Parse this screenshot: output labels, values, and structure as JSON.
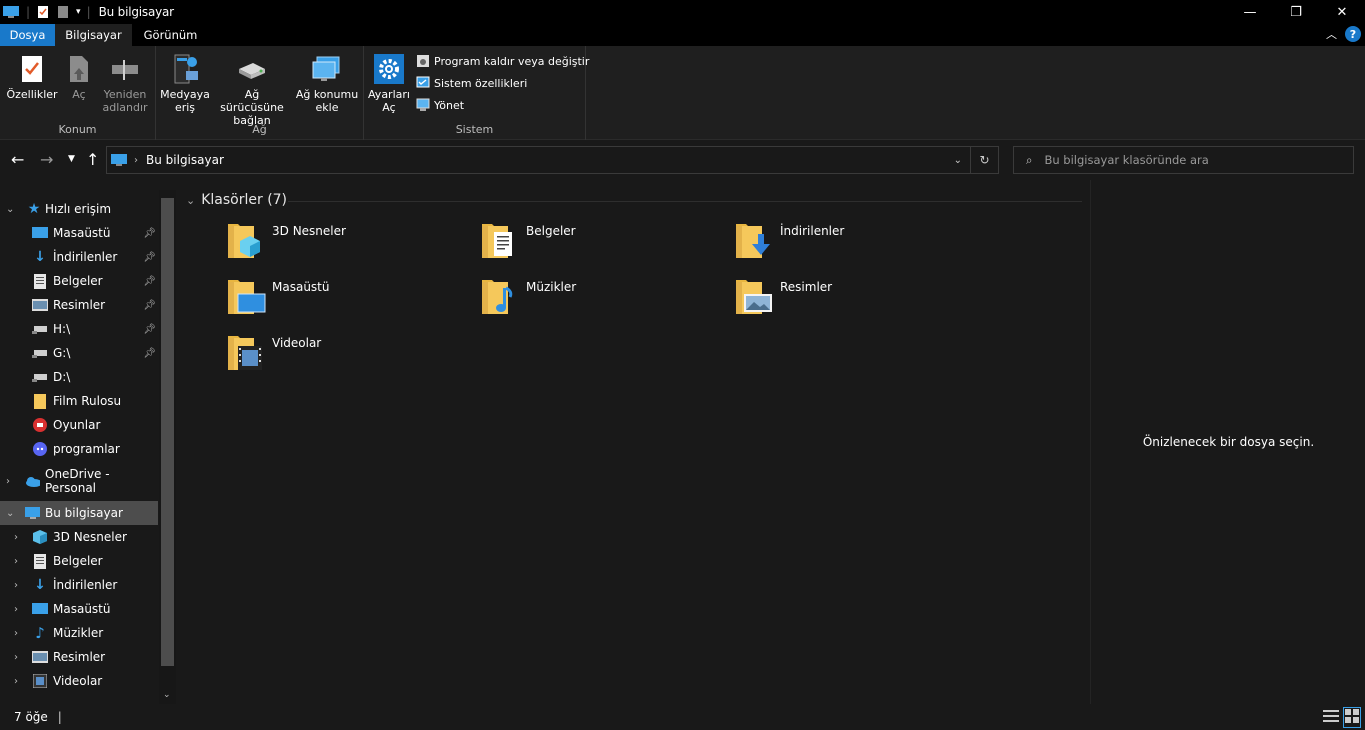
{
  "window": {
    "title": "Bu bilgisayar",
    "minimize": "—",
    "maximize": "❐",
    "close": "✕"
  },
  "ribbon_tabs": [
    "Dosya",
    "Bilgisayar",
    "Görünüm"
  ],
  "ribbon": {
    "konum": {
      "label": "Konum",
      "properties": "Özellikler",
      "open": "Aç",
      "rename_1": "Yeniden",
      "rename_2": "adlandır"
    },
    "ag": {
      "label": "Ağ",
      "media_1": "Medyaya",
      "media_2": "eriş",
      "map_drive_1": "Ağ sürücüsüne",
      "map_drive_2": "bağlan",
      "add_location_1": "Ağ konumu",
      "add_location_2": "ekle"
    },
    "sistem": {
      "label": "Sistem",
      "settings_1": "Ayarları",
      "settings_2": "Aç",
      "uninstall": "Program kaldır veya değiştir",
      "system_props": "Sistem özellikleri",
      "manage": "Yönet"
    }
  },
  "address": {
    "path": "Bu bilgisayar",
    "search_placeholder": "Bu bilgisayar klasöründe ara"
  },
  "nav": {
    "quick_access": "Hızlı erişim",
    "quick_items": [
      {
        "label": "Masaüstü",
        "pinned": true
      },
      {
        "label": "İndirilenler",
        "pinned": true
      },
      {
        "label": "Belgeler",
        "pinned": true
      },
      {
        "label": "Resimler",
        "pinned": true
      },
      {
        "label": "H:\\",
        "pinned": true
      },
      {
        "label": "G:\\",
        "pinned": true
      },
      {
        "label": "D:\\",
        "pinned": false
      },
      {
        "label": "Film Rulosu",
        "pinned": false
      },
      {
        "label": "Oyunlar",
        "pinned": false
      },
      {
        "label": "programlar",
        "pinned": false
      }
    ],
    "onedrive": "OneDrive - Personal",
    "this_pc": "Bu bilgisayar",
    "pc_items": [
      "3D Nesneler",
      "Belgeler",
      "İndirilenler",
      "Masaüstü",
      "Müzikler",
      "Resimler",
      "Videolar"
    ]
  },
  "content": {
    "section_title": "Klasörler (7)",
    "folders": [
      "3D Nesneler",
      "Belgeler",
      "İndirilenler",
      "Masaüstü",
      "Müzikler",
      "Resimler",
      "Videolar"
    ]
  },
  "preview": {
    "text": "Önizlenecek bir dosya seçin."
  },
  "status": {
    "count": "7 öğe"
  },
  "colors": {
    "accent": "#1979ca",
    "background": "#191919",
    "ribbon": "#1f1f1f",
    "folder": "#f5c85b"
  }
}
